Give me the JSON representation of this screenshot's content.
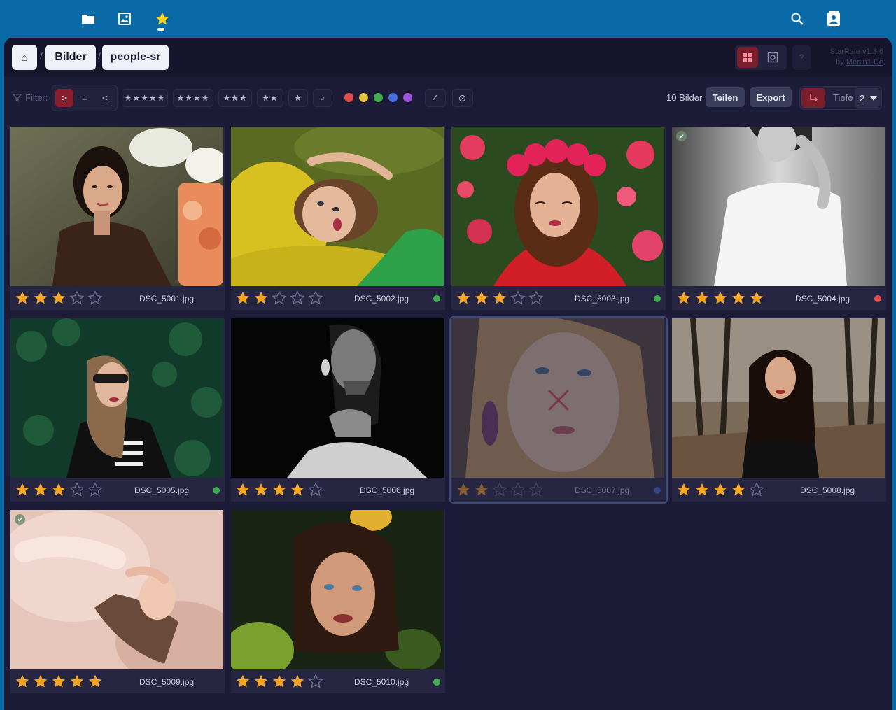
{
  "topnav": {
    "icons": [
      "folder-icon",
      "image-icon",
      "star-icon",
      "search-icon",
      "contact-card-icon"
    ]
  },
  "header": {
    "home_icon": "⌂",
    "breadcrumbs": [
      {
        "label": "Bilder"
      },
      {
        "label": "people-sr"
      }
    ],
    "separator": "/",
    "help_label": "?",
    "version_label": "StarRate v1.3.6",
    "author_prefix": "by ",
    "author_link": "Merlin1.De"
  },
  "filterbar": {
    "label": "Filter:",
    "compare": [
      {
        "label": "≥",
        "active": true
      },
      {
        "label": "=",
        "active": false
      },
      {
        "label": "≤",
        "active": false
      }
    ],
    "rating_filters": [
      "★★★★★",
      "★★★★",
      "★★★",
      "★★",
      "★",
      "○"
    ],
    "color_filters": [
      "#e24b4b",
      "#e3c23a",
      "#3fae4e",
      "#4a6fe0",
      "#9b52d8"
    ],
    "check_filter": "✓",
    "no_filter": "⊘",
    "count_label": "10 Bilder",
    "share_label": "Teilen",
    "export_label": "Export",
    "depth_label": "Tiefe",
    "depth_value": "2"
  },
  "images": [
    {
      "file": "DSC_5001.jpg",
      "rating": 3,
      "color": null,
      "checked": false,
      "rejected": false
    },
    {
      "file": "DSC_5002.jpg",
      "rating": 2,
      "color": "#3fae4e",
      "checked": false,
      "rejected": false
    },
    {
      "file": "DSC_5003.jpg",
      "rating": 3,
      "color": "#3fae4e",
      "checked": false,
      "rejected": false
    },
    {
      "file": "DSC_5004.jpg",
      "rating": 5,
      "color": "#e24b4b",
      "checked": true,
      "rejected": false
    },
    {
      "file": "DSC_5005.jpg",
      "rating": 3,
      "color": "#3fae4e",
      "checked": false,
      "rejected": false
    },
    {
      "file": "DSC_5006.jpg",
      "rating": 4,
      "color": null,
      "checked": false,
      "rejected": false
    },
    {
      "file": "DSC_5007.jpg",
      "rating": 2,
      "color": "#4a6fe0",
      "checked": false,
      "rejected": true
    },
    {
      "file": "DSC_5008.jpg",
      "rating": 4,
      "color": null,
      "checked": false,
      "rejected": false
    },
    {
      "file": "DSC_5009.jpg",
      "rating": 5,
      "color": null,
      "checked": true,
      "rejected": false
    },
    {
      "file": "DSC_5010.jpg",
      "rating": 4,
      "color": "#3fae4e",
      "checked": false,
      "rejected": false
    }
  ],
  "colors": {
    "star_filled": "#f5a623",
    "star_empty": "#6e7090",
    "accent_red": "#8a1e2c"
  }
}
